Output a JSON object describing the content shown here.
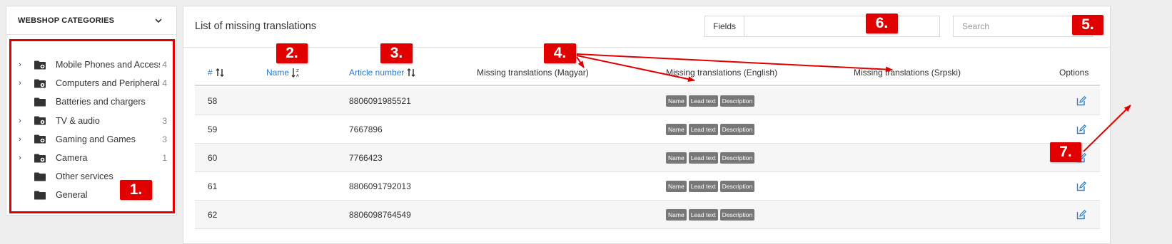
{
  "sidebar": {
    "title": "WEBSHOP CATEGORIES",
    "categories": [
      {
        "name": "Mobile Phones and Accessories",
        "count": "4",
        "expandable": true
      },
      {
        "name": "Computers and Peripherals",
        "count": "4",
        "expandable": true
      },
      {
        "name": "Batteries and chargers",
        "count": "",
        "expandable": false
      },
      {
        "name": "TV & audio",
        "count": "3",
        "expandable": true
      },
      {
        "name": "Gaming and Games",
        "count": "3",
        "expandable": true
      },
      {
        "name": "Camera",
        "count": "1",
        "expandable": true
      },
      {
        "name": "Other services",
        "count": "",
        "expandable": false
      },
      {
        "name": "General",
        "count": "",
        "expandable": false
      }
    ]
  },
  "header": {
    "title": "List of missing translations",
    "fields_label": "Fields",
    "fields_value": "",
    "search_placeholder": "Search"
  },
  "table": {
    "columns": [
      "#",
      "Name",
      "Article number",
      "Missing translations (Magyar)",
      "Missing translations (English)",
      "Missing translations (Srpski)",
      "Options"
    ],
    "badge_labels": [
      "Name",
      "Lead text",
      "Description"
    ],
    "rows": [
      {
        "id": "58",
        "name": "",
        "article": "8806091985521"
      },
      {
        "id": "59",
        "name": "",
        "article": "7667896"
      },
      {
        "id": "60",
        "name": "",
        "article": "7766423"
      },
      {
        "id": "61",
        "name": "",
        "article": "8806091792013"
      },
      {
        "id": "62",
        "name": "",
        "article": "8806098764549"
      }
    ]
  },
  "annotations": [
    "1.",
    "2.",
    "3.",
    "4.",
    "5.",
    "6.",
    "7."
  ],
  "colors": {
    "accent": "#e10000",
    "link": "#2a7bd3",
    "badge": "#777777"
  }
}
